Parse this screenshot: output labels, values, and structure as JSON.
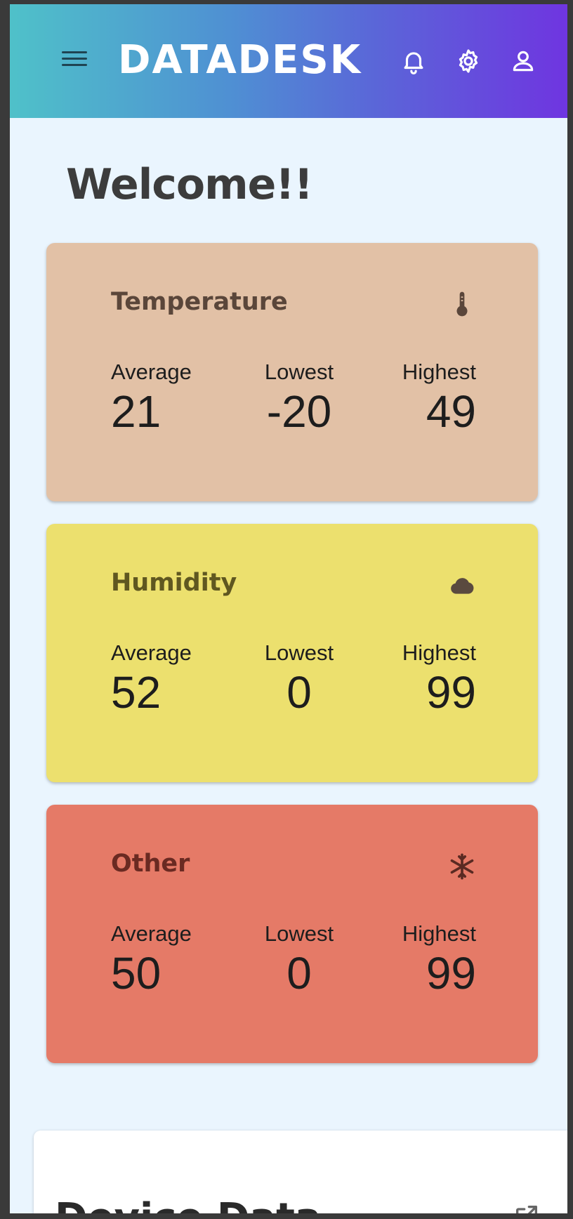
{
  "header": {
    "brand": "DATADESK",
    "icons": [
      "menu-icon",
      "bell-icon",
      "gear-icon",
      "user-icon"
    ]
  },
  "welcome": "Welcome!!",
  "cards": [
    {
      "title": "Temperature",
      "icon": "thermometer-icon",
      "color": "#e2c1a6",
      "title_color": "#5a463a",
      "average_label": "Average",
      "average": "21",
      "lowest_label": "Lowest",
      "lowest": "-20",
      "highest_label": "Highest",
      "highest": "49"
    },
    {
      "title": "Humidity",
      "icon": "cloud-icon",
      "color": "#ece06e",
      "title_color": "#5f5720",
      "average_label": "Average",
      "average": "52",
      "lowest_label": "Lowest",
      "lowest": "0",
      "highest_label": "Highest",
      "highest": "99"
    },
    {
      "title": "Other",
      "icon": "snowflake-icon",
      "color": "#e57a67",
      "title_color": "#6a2a22",
      "average_label": "Average",
      "average": "50",
      "lowest_label": "Lowest",
      "lowest": "0",
      "highest_label": "Highest",
      "highest": "99"
    }
  ],
  "device_panel": {
    "title": "Device Data",
    "icon": "open-external-icon"
  }
}
